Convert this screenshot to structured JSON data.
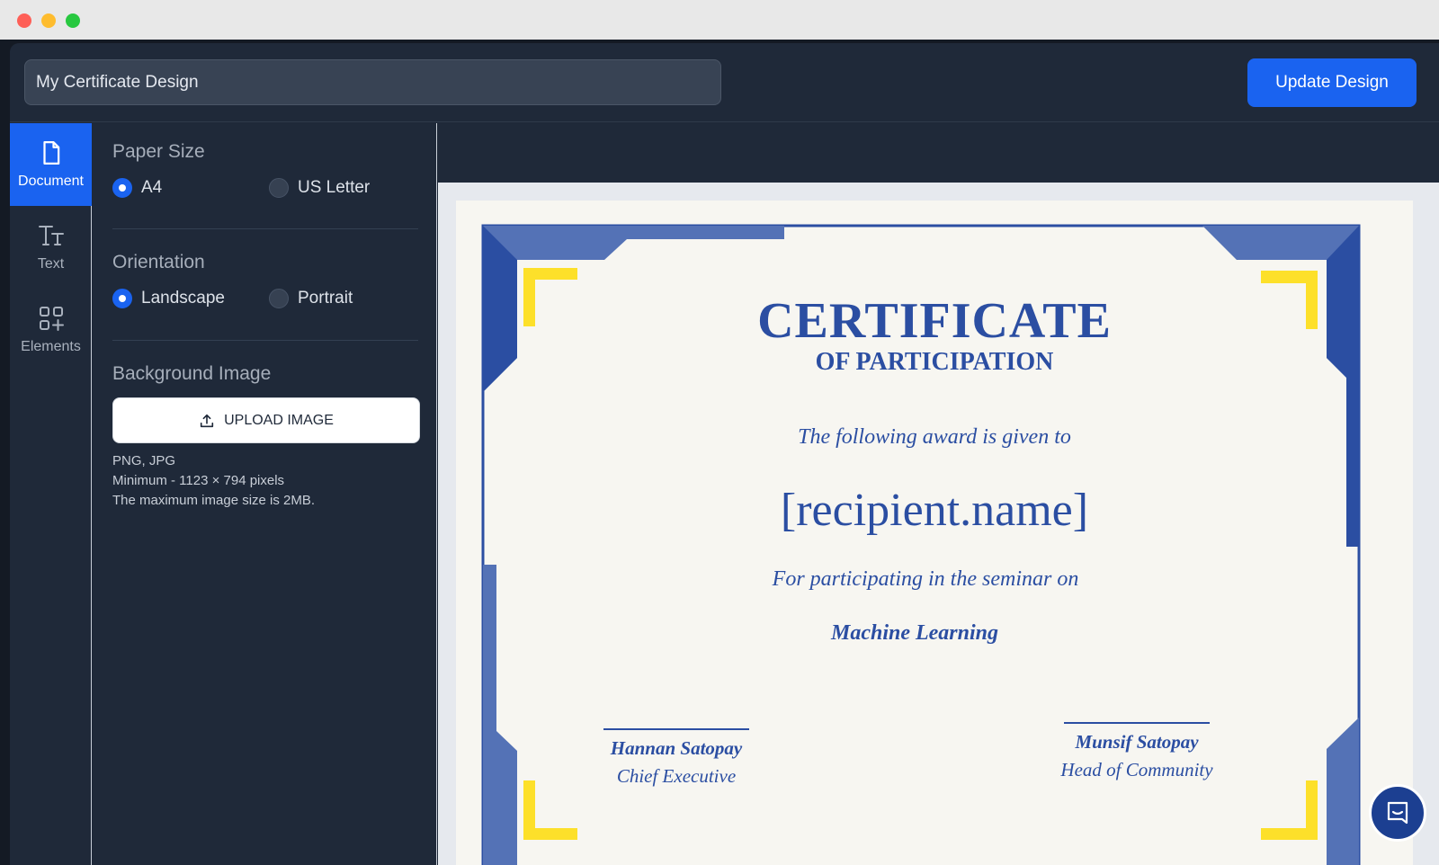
{
  "header": {
    "design_name": "My Certificate Design",
    "update_label": "Update Design"
  },
  "rail": {
    "items": [
      {
        "label": "Document",
        "icon": "document-icon",
        "active": true
      },
      {
        "label": "Text",
        "icon": "text-size-icon",
        "active": false
      },
      {
        "label": "Elements",
        "icon": "elements-grid-icon",
        "active": false
      }
    ]
  },
  "panel": {
    "paper_size": {
      "title": "Paper Size",
      "options": [
        "A4",
        "US Letter"
      ],
      "selected": "A4"
    },
    "orientation": {
      "title": "Orientation",
      "options": [
        "Landscape",
        "Portrait"
      ],
      "selected": "Landscape"
    },
    "background": {
      "title": "Background Image",
      "upload_label": "UPLOAD IMAGE",
      "hints": [
        "PNG, JPG",
        "Minimum - 1123 × 794 pixels",
        "The maximum image size is 2MB."
      ]
    }
  },
  "certificate": {
    "title": "CERTIFICATE",
    "subtitle": "OF PARTICIPATION",
    "given_to": "The following award is given to",
    "recipient": "[recipient.name]",
    "reason": "For participating in the seminar on",
    "topic": "Machine Learning",
    "signatories": [
      {
        "name": "Hannan Satopay",
        "role": "Chief Executive"
      },
      {
        "name": "Munsif Satopay",
        "role": "Head of Community"
      }
    ],
    "colors": {
      "primary": "#2b4ea2",
      "accent": "#fde02a",
      "paper": "#f7f6f1"
    }
  },
  "colors": {
    "accent": "#1a63f0",
    "app_bg": "#1f2939"
  }
}
